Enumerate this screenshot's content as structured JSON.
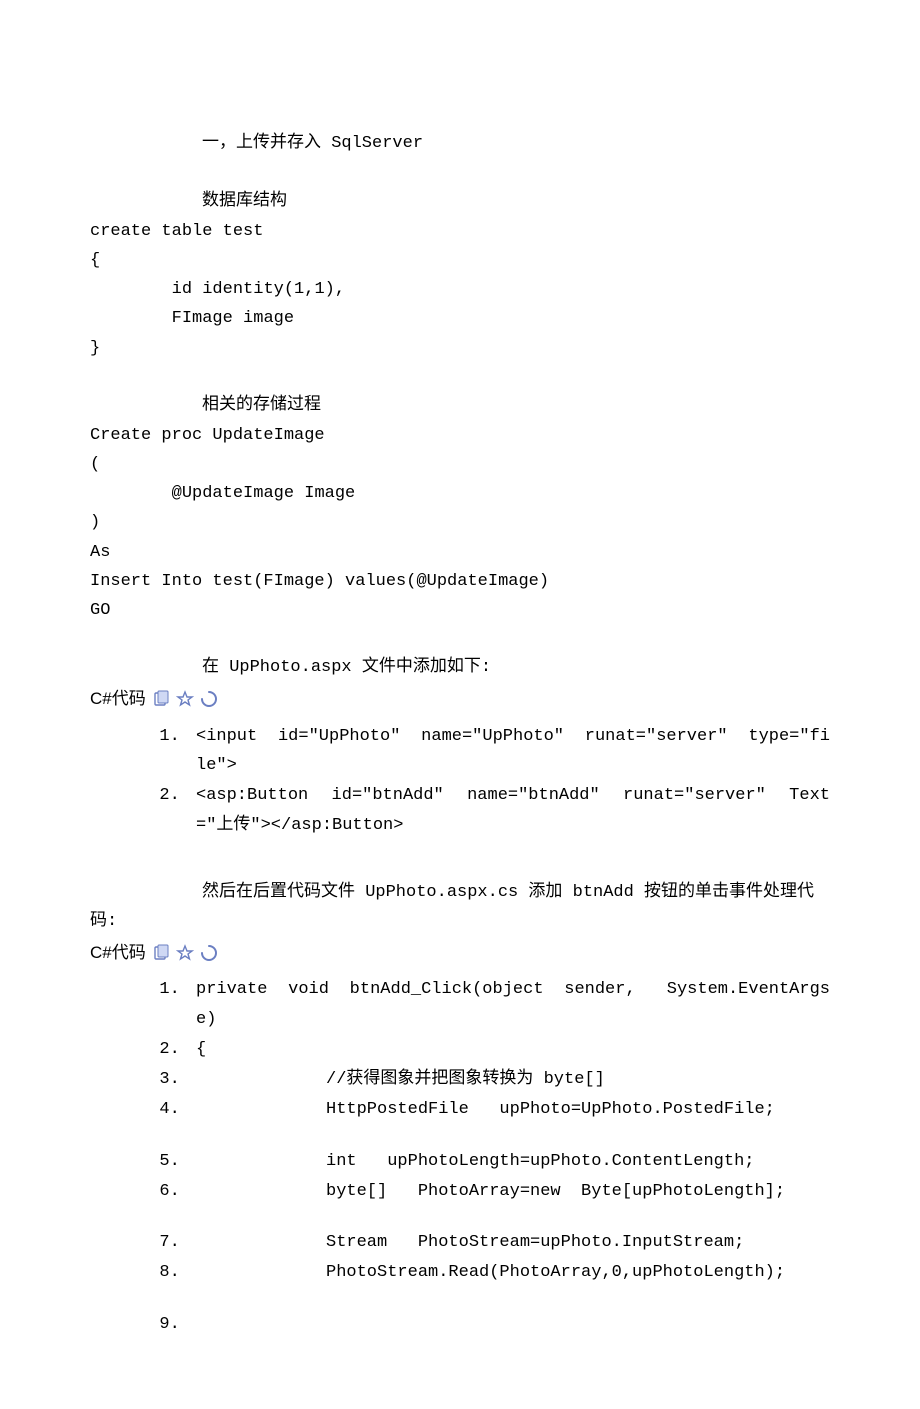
{
  "section1": {
    "title": "一，上传并存入 SqlServer",
    "sub1": "数据库结构",
    "sql1_l1": "create table test",
    "sql1_l2": "{",
    "sql1_l3": "        id identity(1,1),",
    "sql1_l4": "        FImage image",
    "sql1_l5": "}",
    "sub2": "相关的存储过程",
    "sql2_l1": "Create proc UpdateImage",
    "sql2_l2": "(",
    "sql2_l3": "        @UpdateImage Image",
    "sql2_l4": ")",
    "sql2_l5": "As",
    "sql2_l6": "Insert Into test(FImage) values(@UpdateImage)",
    "sql2_l7": "GO",
    "sub3": "在 UpPhoto.aspx 文件中添加如下:"
  },
  "csharp_label": "C#代码",
  "code_block1": {
    "items": [
      "<input  id=\"UpPhoto\"  name=\"UpPhoto\"  runat=\"server\"  type=\"file\">",
      "<asp:Button  id=\"btnAdd\"  name=\"btnAdd\"  runat=\"server\"  Text=\"上传\"></asp:Button>"
    ]
  },
  "section2": {
    "para": "然后在后置代码文件 UpPhoto.aspx.cs 添加 btnAdd 按钮的单击事件处理代码:"
  },
  "code_block2": {
    "l1": "private  void  btnAdd_Click(object  sender,   System.EventArgs  e)",
    "l2": "{",
    "l3": "//获得图象并把图象转换为 byte[]",
    "l4": "HttpPostedFile   upPhoto=UpPhoto.PostedFile;",
    "l5": "int   upPhotoLength=upPhoto.ContentLength;",
    "l6": "byte[]   PhotoArray=new  Byte[upPhotoLength];",
    "l7": "Stream   PhotoStream=upPhoto.InputStream;",
    "l8": "PhotoStream.Read(PhotoArray,0,upPhotoLength);",
    "l9": ""
  }
}
